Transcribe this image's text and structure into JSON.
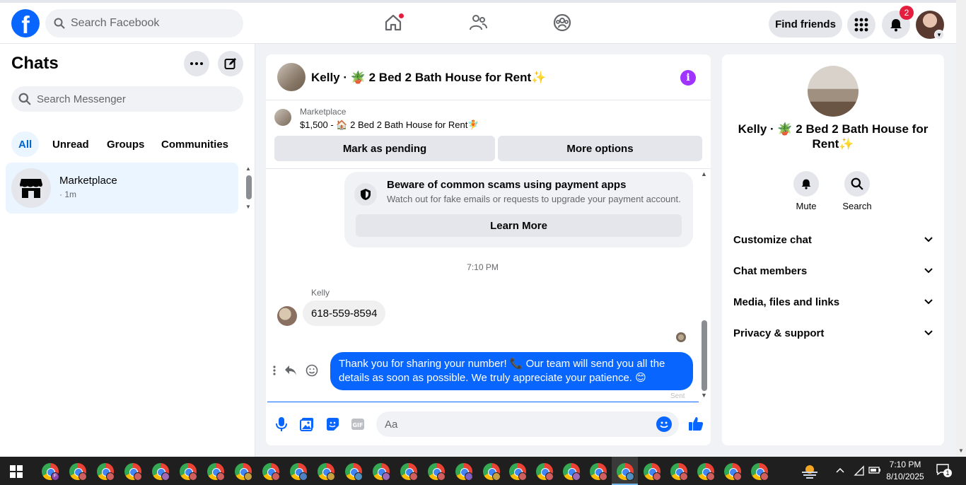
{
  "topnav": {
    "logo": "f",
    "search_placeholder": "Search Facebook",
    "find_friends": "Find friends",
    "notifications_count": "2"
  },
  "chats": {
    "title": "Chats",
    "search_placeholder": "Search Messenger",
    "filters": [
      "All",
      "Unread",
      "Groups",
      "Communities"
    ],
    "items": [
      {
        "name": "Marketplace",
        "time": "· 1m"
      }
    ]
  },
  "conversation": {
    "title": "Kelly · 🪴 2 Bed 2 Bath House for Rent✨",
    "listing": {
      "source": "Marketplace",
      "price_line": "$1,500 - 🏠 2 Bed 2 Bath House for Rent🧚",
      "mark_pending": "Mark as pending",
      "more_options": "More options"
    },
    "warning": {
      "title": "Beware of common scams using payment apps",
      "subtitle": "Watch out for fake emails or requests to upgrade your payment account.",
      "button": "Learn More"
    },
    "timestamp": "7:10 PM",
    "messages": [
      {
        "sender": "Kelly",
        "text": "618-559-8594",
        "direction": "in"
      },
      {
        "sender": "me",
        "text": "Thank you for sharing your number! 📞 Our team will send you all the details as soon as possible. We truly appreciate your patience. 😊",
        "direction": "out"
      }
    ],
    "sent_label": "Sent",
    "composer_placeholder": "Aa"
  },
  "info_panel": {
    "title": "Kelly · 🪴 2 Bed 2 Bath House for Rent✨",
    "actions": [
      "Mute",
      "Search"
    ],
    "sections": [
      "Customize chat",
      "Chat members",
      "Media, files and links",
      "Privacy & support"
    ]
  },
  "taskbar": {
    "time": "7:10 PM",
    "date": "8/10/2025",
    "notification_count": "1"
  },
  "colors": {
    "brand": "#0866ff",
    "active_filter_bg": "#ebf5ff",
    "badge": "#e41e3f",
    "info": "#a033ff"
  }
}
